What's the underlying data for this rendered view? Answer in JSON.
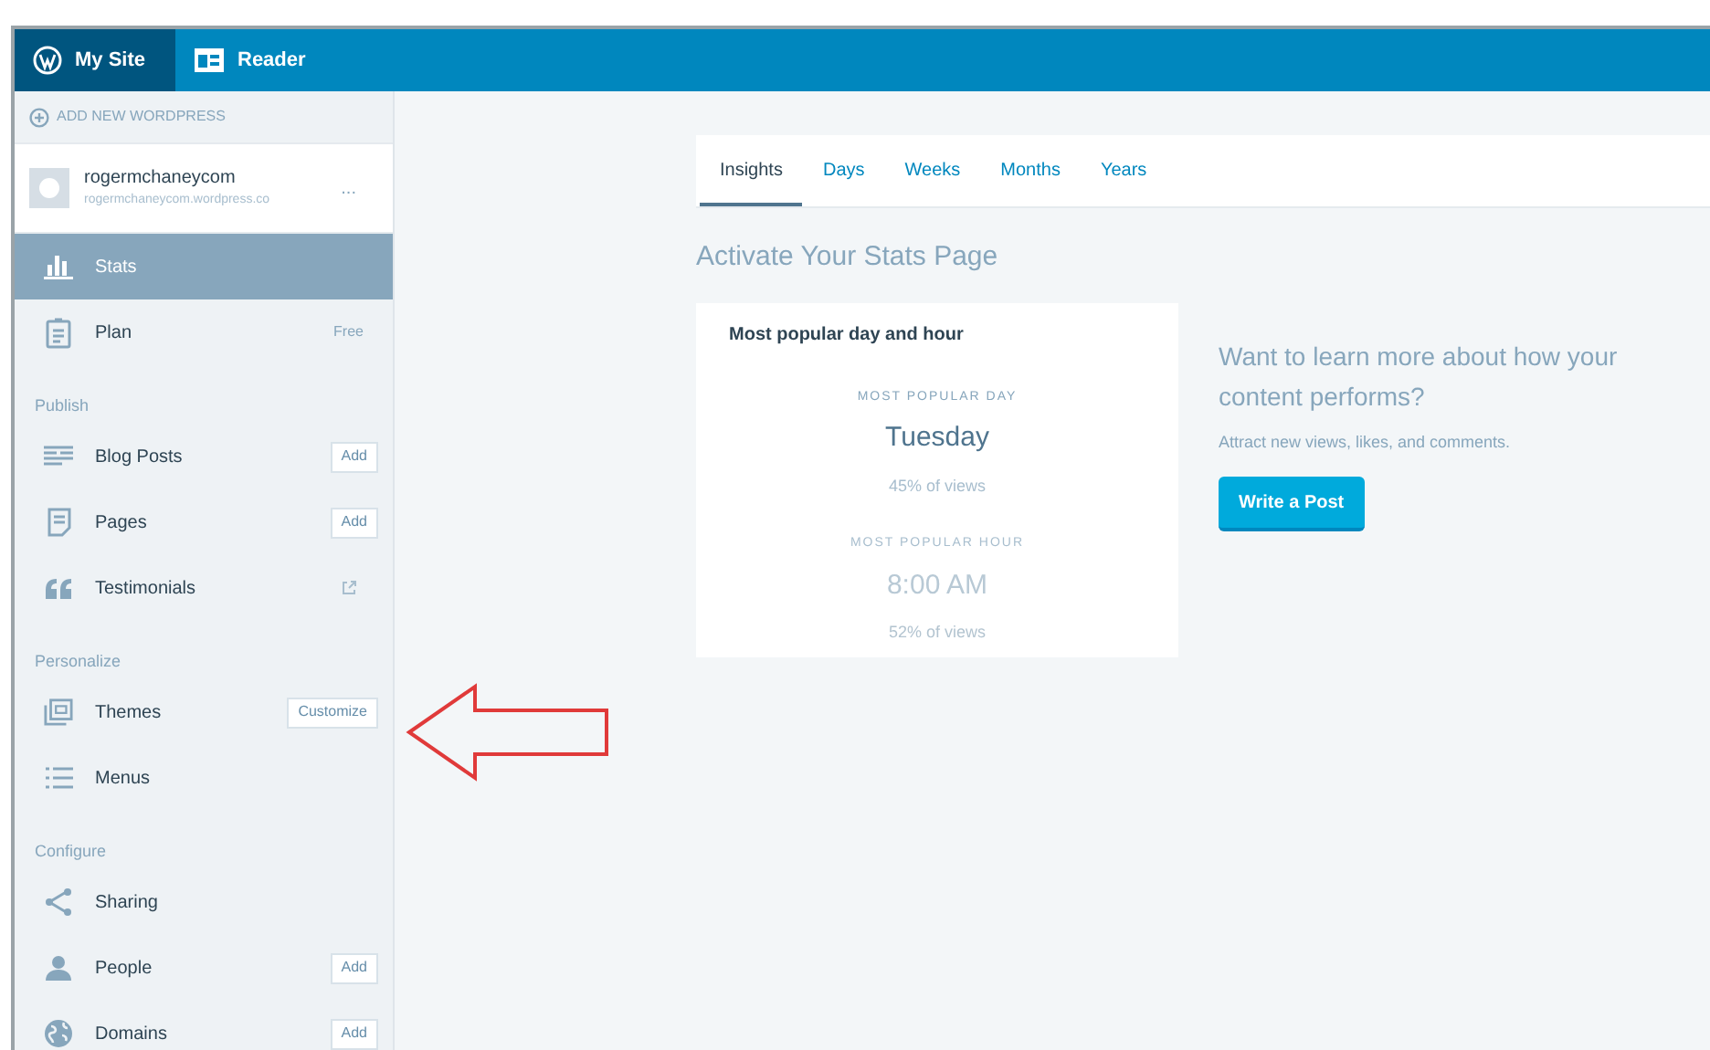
{
  "masterbar": {
    "tabs": [
      {
        "label": "My Site",
        "selected": true
      },
      {
        "label": "Reader",
        "selected": false
      }
    ]
  },
  "sidebar": {
    "add_site": "ADD NEW WORDPRESS",
    "site": {
      "name": "rogermchaneycom",
      "url": "rogermchaneycom.wordpress.co",
      "menu": "..."
    },
    "items": [
      {
        "kind": "item",
        "label": "Stats",
        "selected": true
      },
      {
        "kind": "item",
        "label": "Plan",
        "selected": false,
        "action": {
          "kind": "text",
          "label": "Free"
        }
      },
      {
        "kind": "heading",
        "label": "Publish"
      },
      {
        "kind": "item",
        "label": "Blog Posts",
        "selected": false,
        "action": {
          "kind": "button",
          "label": "Add"
        }
      },
      {
        "kind": "item",
        "label": "Pages",
        "selected": false,
        "action": {
          "kind": "button",
          "label": "Add"
        }
      },
      {
        "kind": "item",
        "label": "Testimonials",
        "selected": false,
        "action": {
          "kind": "external"
        }
      },
      {
        "kind": "heading",
        "label": "Personalize"
      },
      {
        "kind": "item",
        "label": "Themes",
        "selected": false,
        "action": {
          "kind": "button",
          "label": "Customize"
        }
      },
      {
        "kind": "item",
        "label": "Menus",
        "selected": false
      },
      {
        "kind": "heading",
        "label": "Configure"
      },
      {
        "kind": "item",
        "label": "Sharing",
        "selected": false
      },
      {
        "kind": "item",
        "label": "People",
        "selected": false,
        "action": {
          "kind": "button",
          "label": "Add"
        }
      },
      {
        "kind": "item",
        "label": "Domains",
        "selected": false,
        "action": {
          "kind": "button",
          "label": "Add"
        }
      }
    ]
  },
  "stats": {
    "tabs": [
      {
        "label": "Insights",
        "selected": true
      },
      {
        "label": "Days",
        "selected": false
      },
      {
        "label": "Weeks",
        "selected": false
      },
      {
        "label": "Months",
        "selected": false
      },
      {
        "label": "Years",
        "selected": false
      }
    ],
    "heading": "Activate Your Stats Page",
    "card": {
      "title": "Most popular day and hour",
      "day_label": "MOST POPULAR DAY",
      "day": "Tuesday",
      "day_share": "45% of views",
      "hour_label": "MOST POPULAR HOUR",
      "hour": "8:00 AM",
      "hour_share": "52% of views"
    },
    "promo": {
      "title": "Want to learn more about how your content performs?",
      "text": "Attract new views, likes, and comments.",
      "button": "Write a Post"
    }
  }
}
